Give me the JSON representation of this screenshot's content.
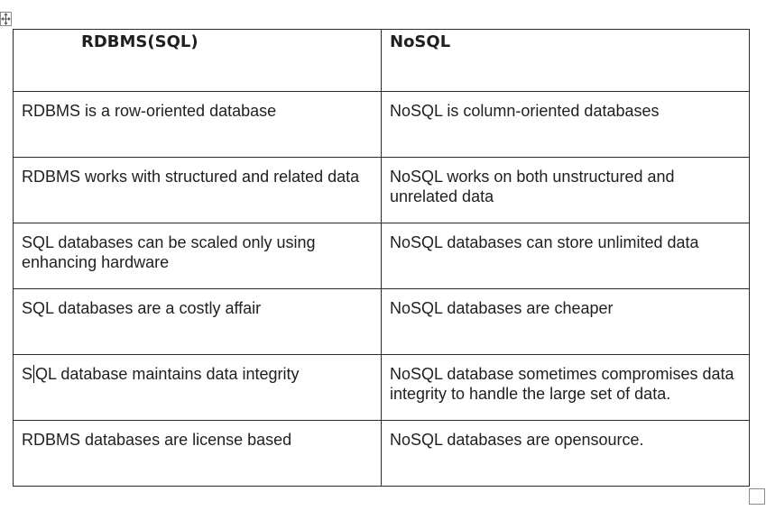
{
  "table": {
    "headers": [
      "RDBMS(SQL)",
      "NoSQL"
    ],
    "rows": [
      [
        "RDBMS is a row-oriented database",
        "NoSQL is column-oriented databases"
      ],
      [
        "RDBMS works with structured and related data",
        "NoSQL works on both unstructured and unrelated data"
      ],
      [
        "SQL databases can be scaled only using enhancing hardware",
        "NoSQL databases can store unlimited data"
      ],
      [
        "SQL databases are a costly affair",
        "NoSQL databases are cheaper"
      ],
      [
        "SQL database maintains data integrity",
        "NoSQL database sometimes compromises data integrity to handle the large set of data."
      ],
      [
        "RDBMS databases are license based",
        "NoSQL databases are opensource."
      ]
    ]
  },
  "caret": {
    "row": 4,
    "col": 0,
    "after_chars": 1
  },
  "icons": {
    "move_handle": "four-way-arrow-icon",
    "resize_handle": "resize-square-icon"
  }
}
